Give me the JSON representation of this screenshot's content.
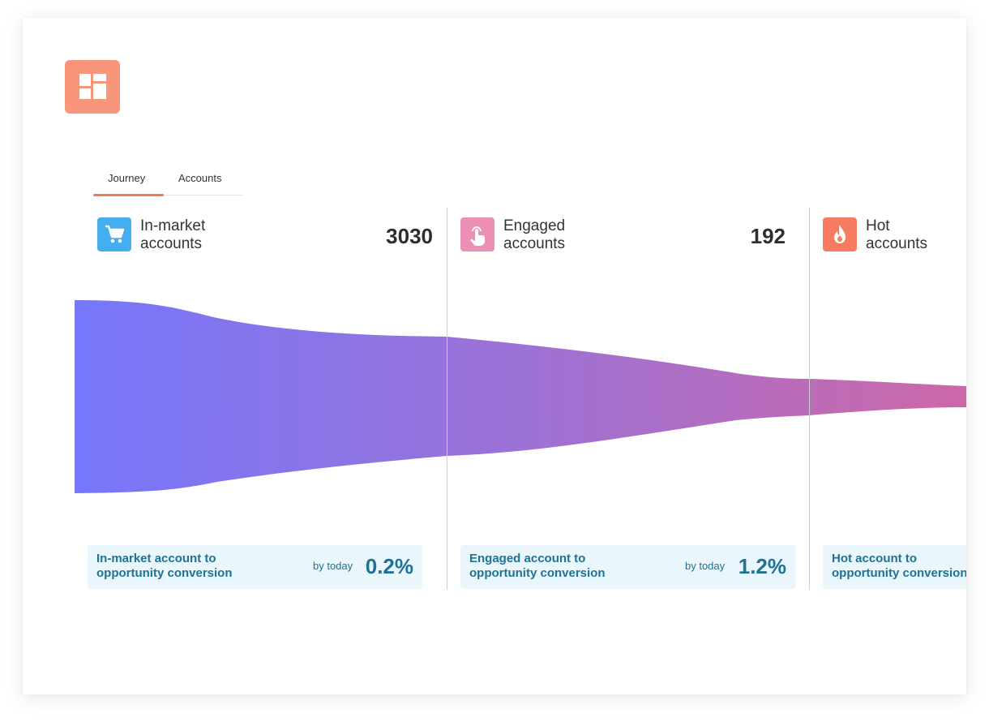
{
  "tabs": [
    {
      "label": "Journey",
      "active": true
    },
    {
      "label": "Accounts",
      "active": false
    }
  ],
  "stages": [
    {
      "title_line1": "In-market",
      "title_line2": "accounts",
      "count": "3030",
      "icon": "cart-icon",
      "icon_color": "#45aef0",
      "conversion": {
        "label": "In-market account to\nopportunity conversion",
        "by": "by today",
        "percent": "0.2%"
      }
    },
    {
      "title_line1": "Engaged",
      "title_line2": "accounts",
      "count": "192",
      "icon": "touch-icon",
      "icon_color": "#ec8fb4",
      "conversion": {
        "label": "Engaged account to\nopportunity conversion",
        "by": "by today",
        "percent": "1.2%"
      }
    },
    {
      "title_line1": "Hot",
      "title_line2": "accounts",
      "icon": "flame-icon",
      "icon_color": "#f77b60",
      "conversion": {
        "label": "Hot account to\nopportunity conversion"
      }
    }
  ],
  "colors": {
    "logo": "#f8967c",
    "tab_accent": "#f07a5a",
    "funnel_start": "#7677fb",
    "funnel_end": "#cd68a8",
    "conversion_text": "#1f7294",
    "conversion_bg": "#e9f6fb"
  }
}
